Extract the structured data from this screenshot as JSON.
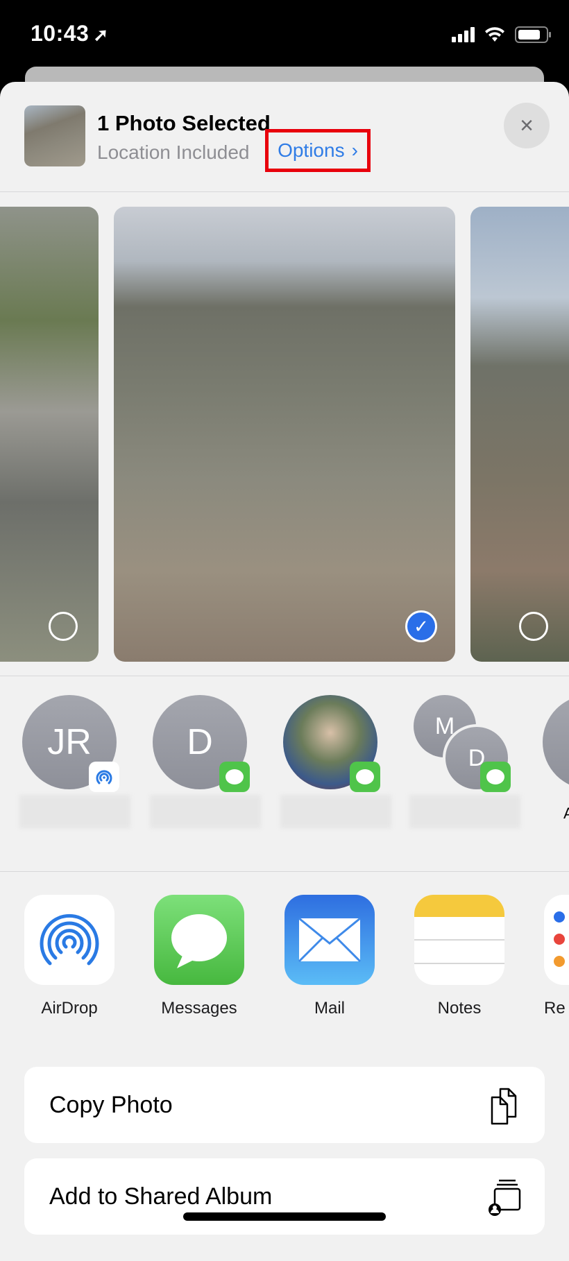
{
  "status_bar": {
    "time": "10:43",
    "location_icon": "location-arrow-icon",
    "signal_icon": "cellular-signal-icon",
    "wifi_icon": "wifi-icon",
    "battery_icon": "battery-icon"
  },
  "share_sheet": {
    "header": {
      "title": "1 Photo Selected",
      "subtitle": "Location Included",
      "options_label": "Options",
      "options_chevron": "›",
      "close_icon": "×",
      "highlight_color": "#e8000c",
      "link_color": "#2f7ce6"
    },
    "photos": [
      {
        "selected": false
      },
      {
        "selected": true
      },
      {
        "selected": false
      }
    ],
    "check_glyph": "✓",
    "people": [
      {
        "initials": "JR",
        "badge": "airdrop",
        "name_blurred": true
      },
      {
        "initials": "D",
        "badge": "messages",
        "name_blurred": true
      },
      {
        "initials": "",
        "badge": "messages",
        "has_photo": true,
        "name_blurred": true
      },
      {
        "initials_group": [
          "M",
          "D"
        ],
        "badge": "messages",
        "name_blurred": true
      },
      {
        "initials": "",
        "partial_label": "A",
        "partially_visible": true
      }
    ],
    "apps": [
      {
        "label": "AirDrop",
        "icon": "airdrop-icon"
      },
      {
        "label": "Messages",
        "icon": "messages-icon"
      },
      {
        "label": "Mail",
        "icon": "mail-icon"
      },
      {
        "label": "Notes",
        "icon": "notes-icon"
      },
      {
        "label": "Re",
        "icon": "reminders-icon",
        "partially_visible": true
      }
    ],
    "actions": [
      {
        "label": "Copy Photo",
        "icon": "copy-icon"
      },
      {
        "label": "Add to Shared Album",
        "icon": "shared-album-icon"
      }
    ]
  }
}
